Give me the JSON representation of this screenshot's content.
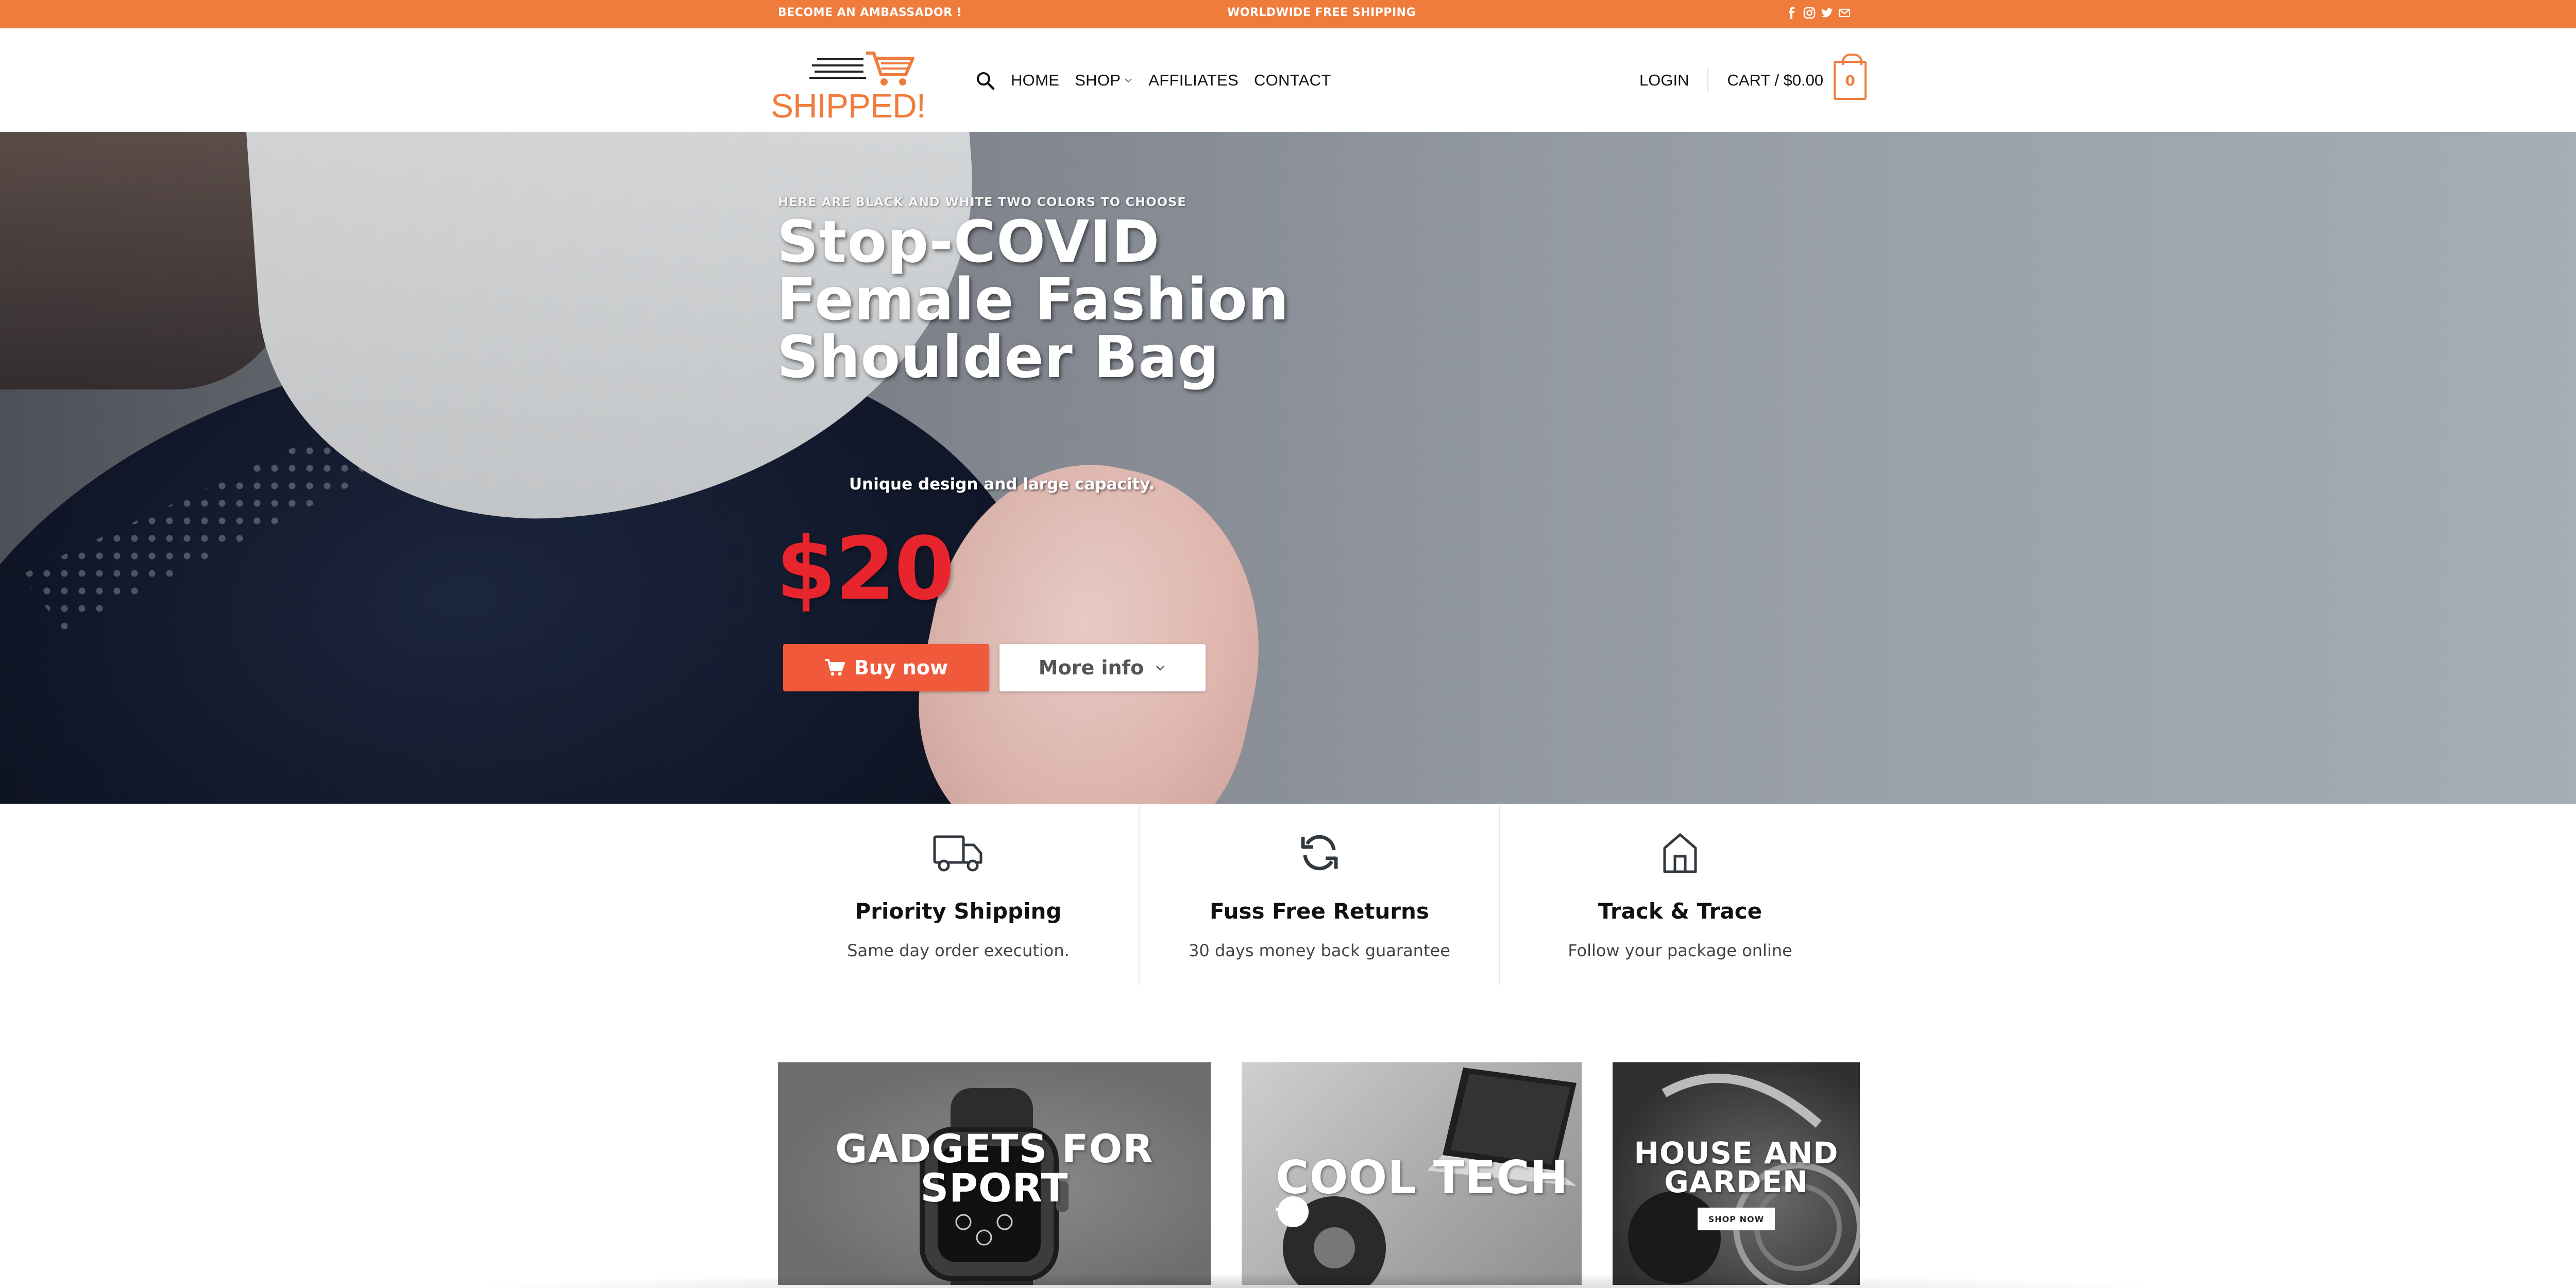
{
  "topbar": {
    "left_link": "BECOME AN AMBASSADOR !",
    "center_text": "WORLDWIDE FREE SHIPPING",
    "social_icons": [
      "facebook-icon",
      "instagram-icon",
      "twitter-icon",
      "envelope-icon"
    ]
  },
  "header": {
    "logo_text": "SHIPPED!",
    "nav": {
      "home": "HOME",
      "shop": "SHOP",
      "affiliates": "AFFILIATES",
      "contact": "CONTACT"
    },
    "login": "LOGIN",
    "cart": "CART / $0.00",
    "cart_count": "0",
    "accent_color": "#f07c3c"
  },
  "hero": {
    "eyebrow": "HERE ARE BLACK AND WHITE TWO COLORS TO CHOOSE",
    "title": "Stop-COVID Female Fashion Shoulder Bag",
    "subtitle": "Unique design and large capacity.",
    "price": "$20",
    "buy_label": "Buy now",
    "more_label": "More info",
    "price_color": "#e8242c",
    "buy_color": "#f05a3a"
  },
  "features": [
    {
      "icon": "truck-icon",
      "title": "Priority Shipping",
      "desc": "Same day order execution."
    },
    {
      "icon": "refresh-icon",
      "title": "Fuss Free Returns",
      "desc": "30 days money back guarantee"
    },
    {
      "icon": "house-icon",
      "title": "Track & Trace",
      "desc": "Follow your package online"
    }
  ],
  "categories": [
    {
      "title": "GADGETS FOR SPORT"
    },
    {
      "title": "COOL TECH"
    },
    {
      "title": "HOUSE AND GARDEN",
      "cta": "SHOP NOW"
    }
  ]
}
